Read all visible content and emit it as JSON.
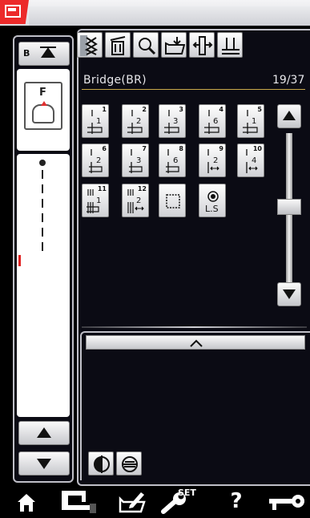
{
  "top_bar": {
    "machine_icon": "sewing-machine-icon",
    "accent": "#ec2a2a"
  },
  "left_panel": {
    "b_button_label": "B",
    "foot_letter": "F",
    "scroll_up_icon": "triangle-up-icon",
    "scroll_down_icon": "triangle-down-icon"
  },
  "toolbar": {
    "items": [
      "stitch-type-icon",
      "delete-icon",
      "zoom-icon",
      "save-icon",
      "foot-icon",
      "needle-plate-icon"
    ]
  },
  "category": {
    "title": "Bridge(BR)",
    "page": "19/37"
  },
  "stitches": [
    {
      "num": "1",
      "val": "1"
    },
    {
      "num": "2",
      "val": "2"
    },
    {
      "num": "3",
      "val": "3"
    },
    {
      "num": "4",
      "val": "6"
    },
    {
      "num": "5",
      "val": "1"
    },
    {
      "num": "6",
      "val": "2"
    },
    {
      "num": "7",
      "val": "3"
    },
    {
      "num": "8",
      "val": "6"
    },
    {
      "num": "9",
      "val": "2"
    },
    {
      "num": "10",
      "val": "4"
    },
    {
      "num": "11",
      "val": "1"
    },
    {
      "num": "12",
      "val": "2"
    }
  ],
  "special_buttons": {
    "ls_label": "L.S"
  },
  "bottom_bar": {
    "set_label": "SET",
    "help_label": "?"
  }
}
